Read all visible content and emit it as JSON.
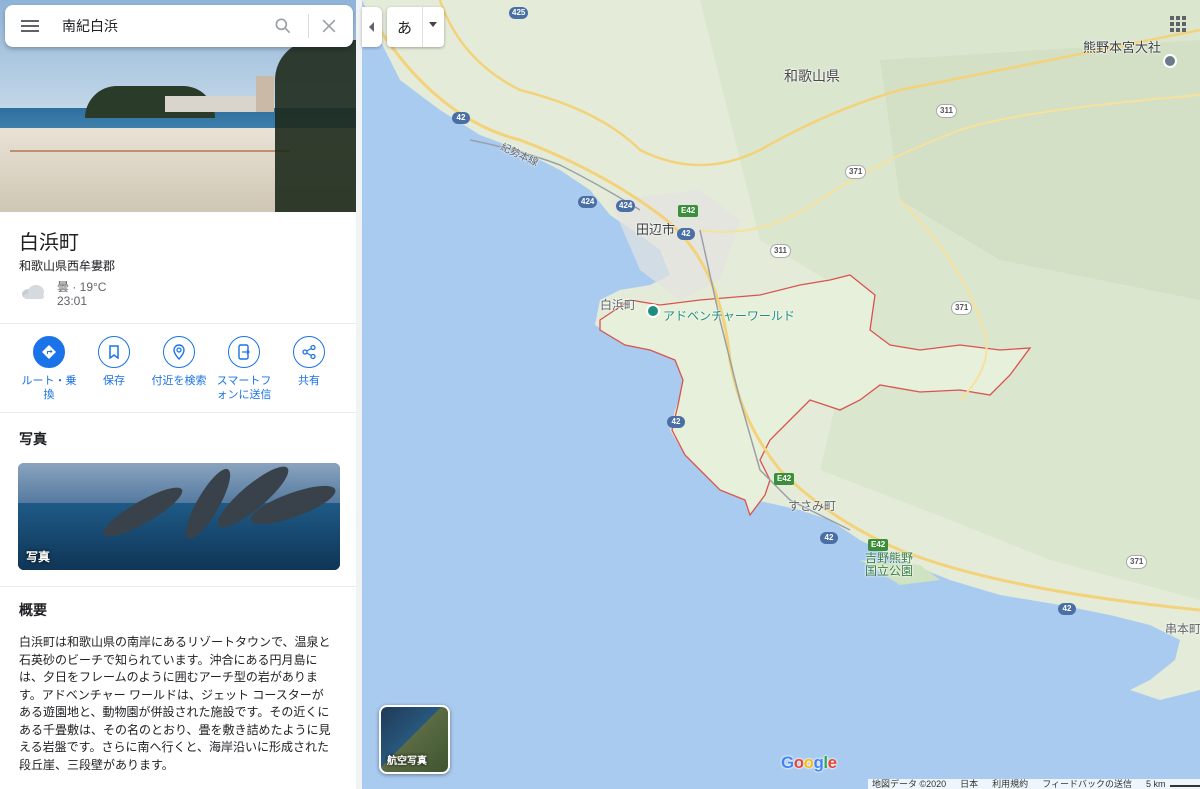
{
  "search": {
    "value": "南紀白浜"
  },
  "place": {
    "title": "白浜町",
    "subtitle": "和歌山県西牟婁郡",
    "weather": "曇 · 19°C",
    "time": "23:01"
  },
  "actions": [
    {
      "label": "ルート・乗換",
      "icon": "directions-icon"
    },
    {
      "label": "保存",
      "icon": "bookmark-icon"
    },
    {
      "label": "付近を検索",
      "icon": "nearby-icon"
    },
    {
      "label": "スマートフォンに送信",
      "icon": "send-to-phone-icon"
    },
    {
      "label": "共有",
      "icon": "share-icon"
    }
  ],
  "photos": {
    "heading": "写真",
    "card_label": "写真"
  },
  "overview": {
    "heading": "概要",
    "text": "白浜町は和歌山県の南岸にあるリゾートタウンで、温泉と石英砂のビーチで知られています。沖合にある円月島には、夕日をフレームのように囲むアーチ型の岩があります。アドベンチャー ワールドは、ジェット コースターがある遊園地と、動物園が併設された施設です。その近くにある千畳敷は、その名のとおり、畳を敷き詰めたように見える岩盤です。さらに南へ行くと、海岸沿いに形成された段丘崖、三段壁があります。"
  },
  "ime": {
    "char": "あ"
  },
  "map": {
    "labels": {
      "pref": "和歌山県",
      "kumano": "熊野本宮大社",
      "tanabe": "田辺市",
      "shirahama": "白浜町",
      "adventure": "アドベンチャーワールド",
      "susami": "すさみ町",
      "park": "吉野熊野\n国立公園",
      "kushimoto": "串本町",
      "kisei": "紀勢本線"
    },
    "shields": [
      "425",
      "42",
      "311",
      "371",
      "424",
      "424",
      "E42",
      "42",
      "311",
      "371",
      "42",
      "E42",
      "42",
      "E42",
      "371",
      "42",
      "311"
    ],
    "satellite_label": "航空写真",
    "google": "Google",
    "attribution": [
      "地図データ ©2020",
      "日本",
      "利用規約",
      "フィードバックの送信",
      "5 km"
    ],
    "colors": {
      "water": "#aacbf0",
      "land": "#e6eedc",
      "boundary": "#d9534f",
      "accent": "#1a73e8"
    }
  }
}
